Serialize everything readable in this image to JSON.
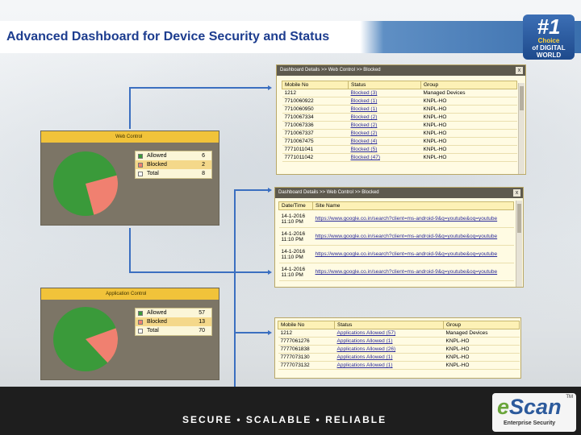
{
  "slide": {
    "title": "Advanced Dashboard for Device Security and Status",
    "tagline": "SECURE • SCALABLE • RELIABLE"
  },
  "award": {
    "number": "#1",
    "choice": "Choice",
    "of": "of DIGITAL",
    "world": "WORLD"
  },
  "logo": {
    "brand_e": "e",
    "brand_rest": "Scan",
    "tm": "TM",
    "sub": "Enterprise Security"
  },
  "web_control": {
    "header": "Web Control",
    "legend": [
      {
        "label": "Allowed",
        "value": "6",
        "color": "#3a9a3a"
      },
      {
        "label": "Blocked",
        "value": "2",
        "color": "#f08070"
      },
      {
        "label": "Total",
        "value": "8",
        "color": "#ffffff"
      }
    ],
    "pie": {
      "blocked_fraction": 0.25
    }
  },
  "web_detail_status": {
    "header": "Dashboard Details >> Web Control >> Blocked",
    "close": "x",
    "columns": [
      "Mobile No",
      "Status",
      "Group"
    ],
    "rows": [
      [
        "1212",
        "Blocked (3)",
        "Managed Devices"
      ],
      [
        "7710060922",
        "Blocked (1)",
        "KNPL-HO"
      ],
      [
        "7710060950",
        "Blocked (1)",
        "KNPL-HO"
      ],
      [
        "7710067334",
        "Blocked (2)",
        "KNPL-HO"
      ],
      [
        "7710067336",
        "Blocked (2)",
        "KNPL-HO"
      ],
      [
        "7710067337",
        "Blocked (2)",
        "KNPL-HO"
      ],
      [
        "7710067475",
        "Blocked (4)",
        "KNPL-HO"
      ],
      [
        "7771011041",
        "Blocked (5)",
        "KNPL-HO"
      ],
      [
        "7771011042",
        "Blocked (47)",
        "KNPL-HO"
      ]
    ]
  },
  "web_detail_sites": {
    "header": "Dashboard Details >> Web Control >> Blocked",
    "close": "x",
    "columns": [
      "Date/Time",
      "Site Name"
    ],
    "rows": [
      [
        "14-1-2016 11:10 PM",
        "https://www.google.co.in/search?client=ms-android-9&q=youtube&oq=youtube"
      ],
      [
        "14-1-2016 11:10 PM",
        "https://www.google.co.in/search?client=ms-android-9&q=youtube&oq=youtube"
      ],
      [
        "14-1-2016 11:10 PM",
        "https://www.google.co.in/search?client=ms-android-9&q=youtube&oq=youtube"
      ],
      [
        "14-1-2016 11:10 PM",
        "https://www.google.co.in/search?client=ms-android-9&q=youtube&oq=youtube"
      ]
    ]
  },
  "app_control": {
    "header": "Application Control",
    "legend": [
      {
        "label": "Allowed",
        "value": "57",
        "color": "#3a9a3a"
      },
      {
        "label": "Blocked",
        "value": "13",
        "color": "#f08070"
      },
      {
        "label": "Total",
        "value": "70",
        "color": "#ffffff"
      }
    ],
    "pie": {
      "blocked_fraction": 0.186
    }
  },
  "app_detail": {
    "columns": [
      "Mobile No",
      "Status",
      "Group"
    ],
    "rows": [
      [
        "1212",
        "Applications Allowed (57)",
        "Managed Devices"
      ],
      [
        "7777061276",
        "Applications Allowed (1)",
        "KNPL-HO"
      ],
      [
        "7777061838",
        "Applications Allowed (26)",
        "KNPL-HO"
      ],
      [
        "7777073130",
        "Applications Allowed (1)",
        "KNPL-HO"
      ],
      [
        "7777073132",
        "Applications Allowed (1)",
        "KNPL-HO"
      ]
    ]
  }
}
